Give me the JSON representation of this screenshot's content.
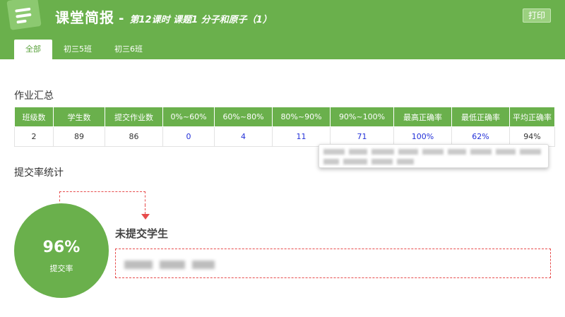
{
  "header": {
    "app_title": "课堂简报",
    "separator": "-",
    "lesson_title": "第12课时 课题1 分子和原子（1）",
    "print_label": "打印"
  },
  "tabs": [
    {
      "label": "全部",
      "active": true
    },
    {
      "label": "初三5班",
      "active": false
    },
    {
      "label": "初三6班",
      "active": false
    }
  ],
  "homework_summary": {
    "title": "作业汇总",
    "columns": [
      "班级数",
      "学生数",
      "提交作业数",
      "0%~60%",
      "60%~80%",
      "80%~90%",
      "90%~100%",
      "最高正确率",
      "最低正确率",
      "平均正确率"
    ],
    "row": [
      "2",
      "89",
      "86",
      "0",
      "4",
      "11",
      "71",
      "100%",
      "62%",
      "94%"
    ]
  },
  "submission": {
    "title": "提交率统计",
    "rate": "96%",
    "rate_label": "提交率",
    "unsubmitted_title": "未提交学生"
  },
  "colors": {
    "brand_green": "#6ab04c",
    "link_blue": "#2330d8",
    "dashed_red": "#e74c4c"
  },
  "icons": {
    "logo": "notepad-icon",
    "arrow": "arrow-down-icon"
  }
}
